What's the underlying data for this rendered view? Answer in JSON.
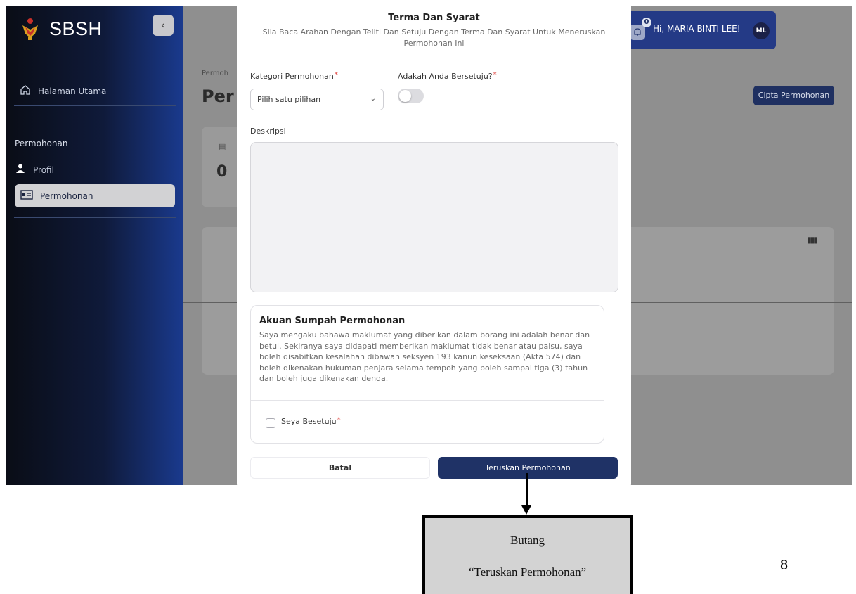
{
  "sidebar": {
    "logo_text": "SBSH",
    "collapse_icon": "chevron-left-icon",
    "home_label": "Halaman Utama",
    "section_label": "Permohonan",
    "items": [
      {
        "label": "Profil",
        "icon": "user-icon"
      },
      {
        "label": "Permohonan",
        "icon": "id-card-icon"
      }
    ]
  },
  "background": {
    "breadcrumb": "Permoh",
    "page_title": "Per",
    "stat_value": "0",
    "create_button": "Cipta Permohonan"
  },
  "header": {
    "notification_count": "0",
    "greeting": "Hi, MARIA BINTI LEE!",
    "avatar_initials": "ML"
  },
  "modal": {
    "title": "Terma Dan Syarat",
    "subtitle": "Sila Baca Arahan Dengan Teliti Dan Setuju Dengan Terma Dan Syarat Untuk Meneruskan Permohonan Ini",
    "category_label": "Kategori Permohonan",
    "category_placeholder": "Pilih satu pilihan",
    "agree_label": "Adakah Anda Bersetuju?",
    "agree_on": false,
    "description_label": "Deskripsi",
    "description_value": "",
    "oath_title": "Akuan Sumpah Permohonan",
    "oath_text": "Saya mengaku bahawa maklumat yang diberikan dalam borang ini adalah benar dan betul. Sekiranya saya didapati memberikan maklumat tidak benar atau palsu, saya boleh disabitkan kesalahan dibawah seksyen 193 kanun keseksaan (Akta 574) dan boleh dikenakan hukuman penjara selama tempoh yang boleh sampai tiga (3) tahun dan boleh juga dikenakan denda.",
    "oath_checkbox_label": "Seya Besetuju",
    "oath_checked": false,
    "cancel_button": "Batal",
    "submit_button": "Teruskan Permohonan"
  },
  "annotation": {
    "line1": "Butang",
    "line2": "“Teruskan Permohonan”"
  },
  "page_number": "8",
  "colors": {
    "primary": "#1f3266",
    "required": "#e0403b"
  }
}
